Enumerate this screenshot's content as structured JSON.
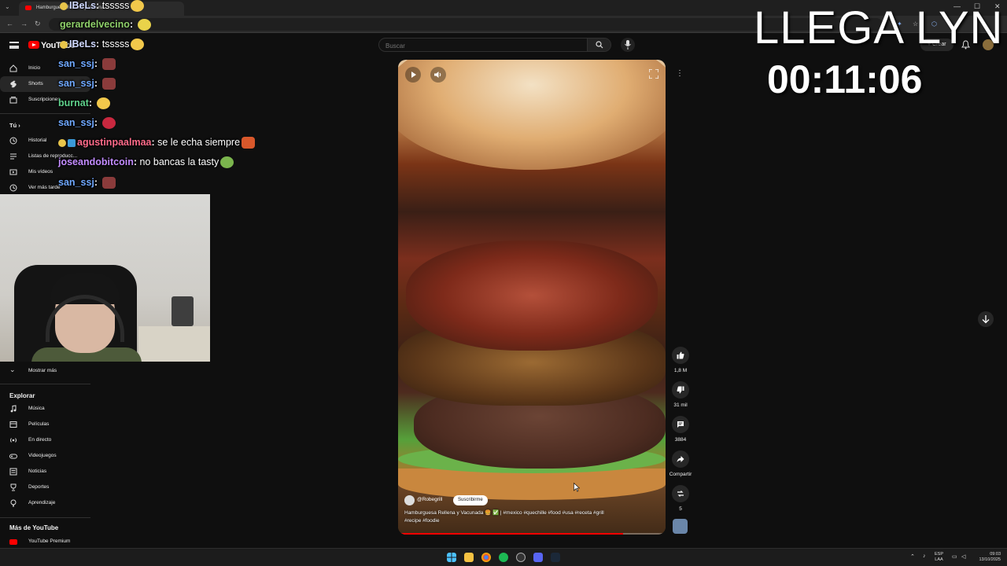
{
  "browser": {
    "tab_title": "Hamburguesa Rellena y Vacuna",
    "window_controls": [
      "—",
      "☐",
      "✕"
    ]
  },
  "youtube": {
    "logo_text": "YouTube",
    "search_placeholder": "Buscar",
    "create_label": "Crear"
  },
  "sidebar": {
    "main_items": [
      {
        "label": "Inicio",
        "icon": "home-icon"
      },
      {
        "label": "Shorts",
        "icon": "shorts-icon"
      },
      {
        "label": "Suscripciones",
        "icon": "subscriptions-icon"
      }
    ],
    "you_heading": "Tú",
    "you_items": [
      {
        "label": "Historial",
        "icon": "history-icon"
      },
      {
        "label": "Listas de reproducc...",
        "icon": "playlists-icon"
      },
      {
        "label": "Mis vídeos",
        "icon": "your-videos-icon"
      },
      {
        "label": "Ver más tarde",
        "icon": "watch-later-icon"
      }
    ],
    "show_more": "Mostrar más",
    "explore_heading": "Explorar",
    "explore_items": [
      {
        "label": "Música",
        "icon": "music-icon"
      },
      {
        "label": "Películas",
        "icon": "movies-icon"
      },
      {
        "label": "En directo",
        "icon": "live-icon"
      },
      {
        "label": "Videojuegos",
        "icon": "gaming-icon"
      },
      {
        "label": "Noticias",
        "icon": "news-icon"
      },
      {
        "label": "Deportes",
        "icon": "sports-icon"
      },
      {
        "label": "Aprendizaje",
        "icon": "learning-icon"
      }
    ],
    "more_heading": "Más de YouTube",
    "more_items": [
      {
        "label": "YouTube Premium",
        "icon": "youtube-premium-icon"
      }
    ]
  },
  "chat": [
    {
      "user": "IBeLs",
      "message": "tsssss",
      "color": "#cfd8ff"
    },
    {
      "user": "gerardelvecino",
      "message": "",
      "color": "#8fd16a"
    },
    {
      "user": "IBeLs",
      "message": "tsssss",
      "color": "#cfd8ff"
    },
    {
      "user": "san_ssj",
      "message": "",
      "color": "#6fa8ff"
    },
    {
      "user": "san_ssj",
      "message": "",
      "color": "#6fa8ff"
    },
    {
      "user": "burnat",
      "message": "",
      "color": "#5fd08b"
    },
    {
      "user": "san_ssj",
      "message": "",
      "color": "#6fa8ff"
    },
    {
      "user": "agustinpaalmaa",
      "message": "se le echa siempre",
      "color": "#ff6b8a"
    },
    {
      "user": "joseandobitcoin",
      "message": "no bancas la tasty",
      "color": "#c38cff"
    },
    {
      "user": "san_ssj",
      "message": "",
      "color": "#6fa8ff"
    }
  ],
  "short": {
    "channel": "@Robegrill",
    "subscribe_label": "Suscribirme",
    "title": "Hamburguesa Rellena y Vacunada 🍔 ✅ | #mexico #quechille #food #usa #receta #grill #recipe #foodie",
    "progress": 0.84
  },
  "actions": {
    "likes": "1,8 M",
    "dislikes": "31 mil",
    "comments": "3884",
    "share": "Compartir",
    "remix": "5"
  },
  "overlay": {
    "title": "LLEGA LYN",
    "timer": "00:11:06"
  },
  "taskbar": {
    "lang_top": "ESP",
    "lang_bottom": "LAA",
    "time": "09:03",
    "date": "13/10/2025"
  }
}
